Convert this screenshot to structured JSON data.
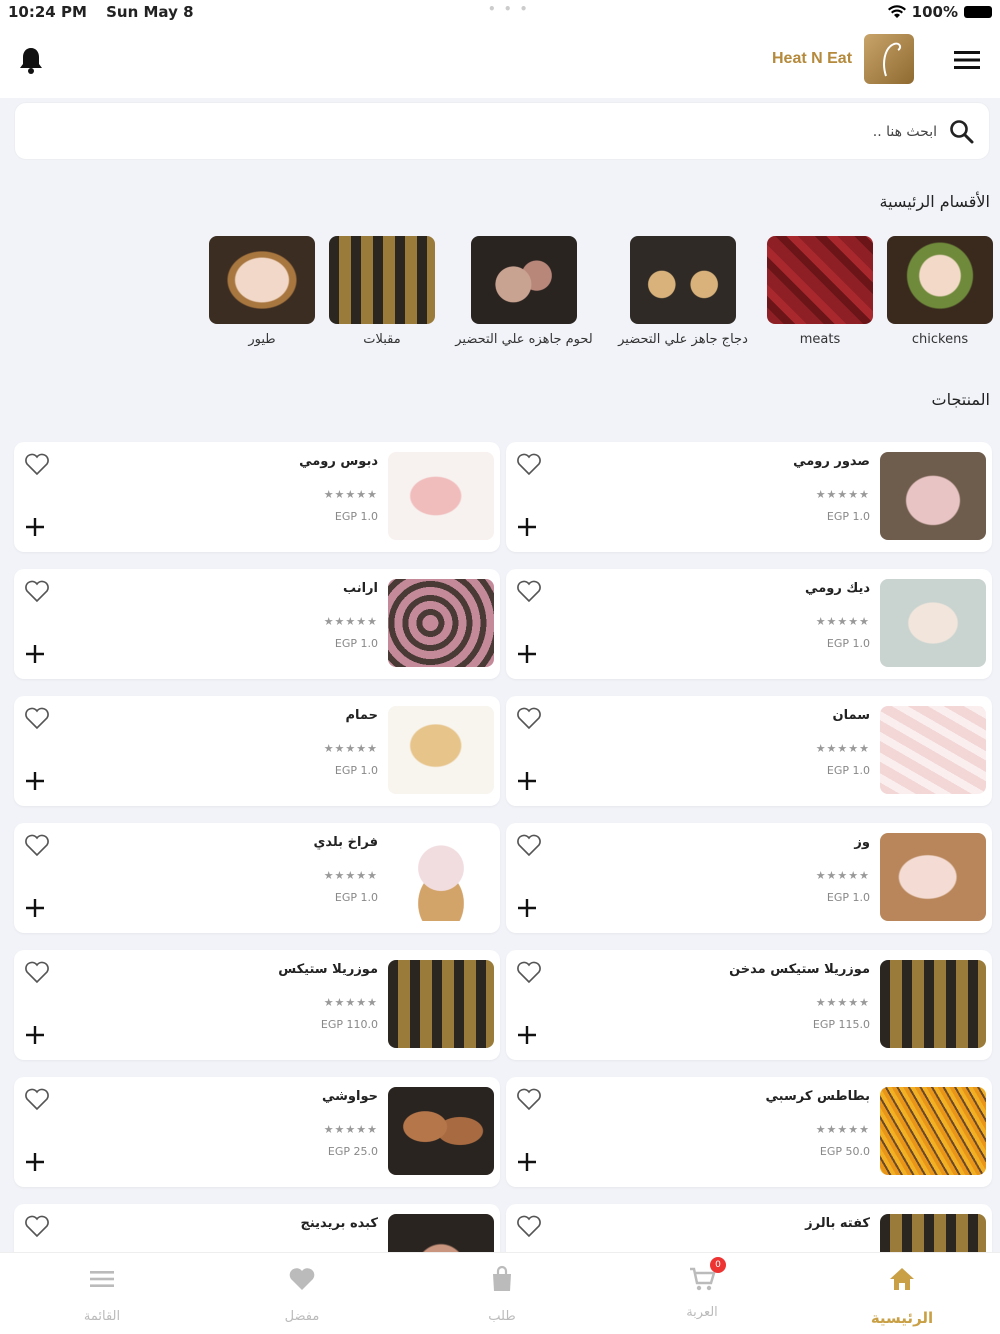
{
  "status": {
    "time": "10:24 PM",
    "date": "Sun May 8",
    "battery": "100%"
  },
  "header": {
    "brand": "Heat N Eat"
  },
  "search": {
    "placeholder": "ابحث هنا .."
  },
  "categories": {
    "title": "الأقسام الرئيسية",
    "items": [
      {
        "label": "chickens",
        "icon": "chickens-image"
      },
      {
        "label": "meats",
        "icon": "meats-image"
      },
      {
        "label": "دجاج جاهز علي التحضير",
        "icon": "ready-chicken-image"
      },
      {
        "label": "لحوم جاهزه علي التحضير",
        "icon": "ready-meat-image"
      },
      {
        "label": "مقبلات",
        "icon": "appetizers-image"
      },
      {
        "label": "طيور",
        "icon": "birds-image"
      }
    ]
  },
  "products": {
    "title": "المنتجات",
    "items": [
      {
        "name": "صدور رومي",
        "rating": "★★★★★",
        "price": "EGP 1.0"
      },
      {
        "name": "دبوس رومي",
        "rating": "★★★★★",
        "price": "EGP 1.0"
      },
      {
        "name": "ديك رومي",
        "rating": "★★★★★",
        "price": "EGP 1.0"
      },
      {
        "name": "ارانب",
        "rating": "★★★★★",
        "price": "EGP 1.0"
      },
      {
        "name": "سمان",
        "rating": "★★★★★",
        "price": "EGP 1.0"
      },
      {
        "name": "حمام",
        "rating": "★★★★★",
        "price": "EGP 1.0"
      },
      {
        "name": "وز",
        "rating": "★★★★★",
        "price": "EGP 1.0"
      },
      {
        "name": "فراخ بلدي",
        "rating": "★★★★★",
        "price": "EGP 1.0"
      },
      {
        "name": "موزريلا ستيكس مدخن",
        "rating": "★★★★★",
        "price": "EGP 115.0"
      },
      {
        "name": "موزريلا ستيكس",
        "rating": "★★★★★",
        "price": "EGP 110.0"
      },
      {
        "name": "بطاطس كرسبي",
        "rating": "★★★★★",
        "price": "EGP 50.0"
      },
      {
        "name": "حواوشي",
        "rating": "★★★★★",
        "price": "EGP 25.0"
      },
      {
        "name": "كفته بالرز",
        "rating": "",
        "price": ""
      },
      {
        "name": "كبده بريدينج",
        "rating": "",
        "price": ""
      }
    ]
  },
  "tabs": {
    "home": "الرئيسية",
    "cart": "العربة",
    "cart_badge": "0",
    "orders": "طلب",
    "favorites": "مفضل",
    "menu": "القائمة"
  },
  "colors": {
    "accent": "#c9a046",
    "brand": "#b58a3c"
  }
}
